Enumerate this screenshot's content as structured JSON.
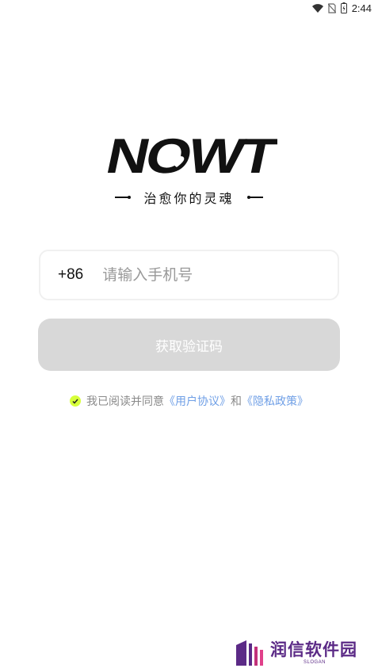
{
  "status_bar": {
    "time": "2:44"
  },
  "logo": {
    "text": "NOWT"
  },
  "slogan": "治愈你的灵魂",
  "phone": {
    "prefix": "+86",
    "placeholder": "请输入手机号",
    "value": ""
  },
  "get_code_button": "获取验证码",
  "agreement": {
    "checked": true,
    "prefix_text": "我已阅读并同意",
    "user_agreement": "《用户协议》",
    "and_text": "和",
    "privacy_policy": "《隐私政策》"
  },
  "watermark": {
    "text": "润信软件园",
    "sub": "SLOGAN"
  },
  "colors": {
    "accent_check": "#d7ff3a",
    "link": "#6f9fe6",
    "button_disabled": "#d8d8d8",
    "watermark": "#5b2a86"
  }
}
